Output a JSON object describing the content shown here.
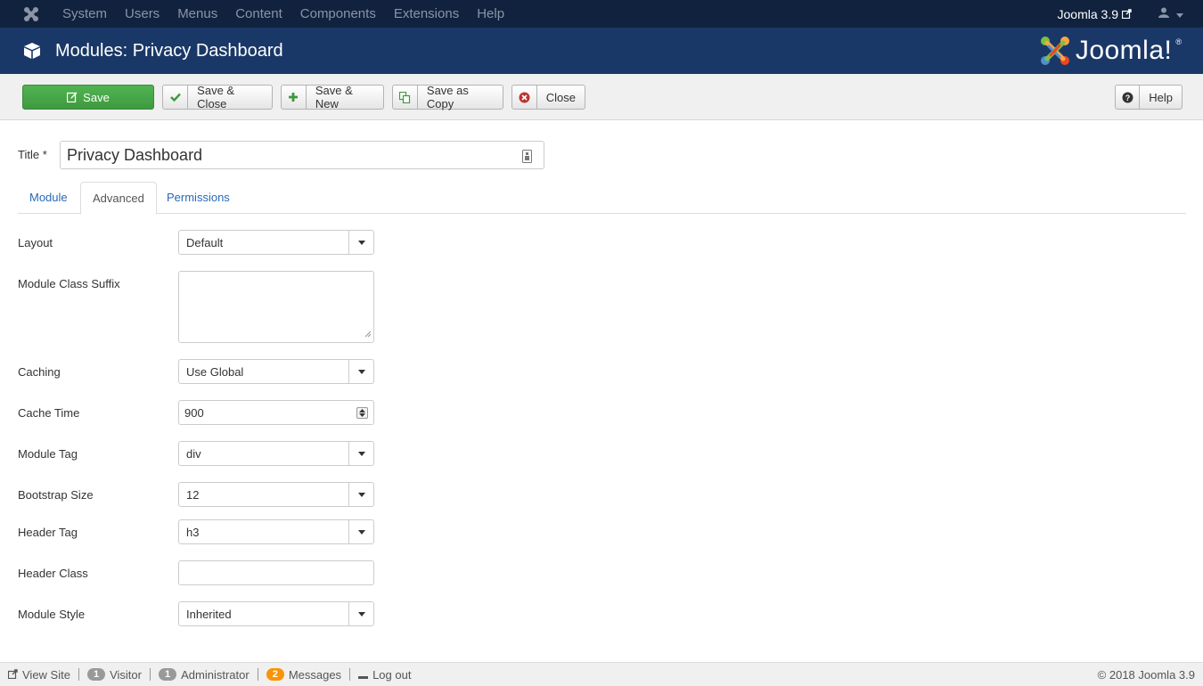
{
  "navbar": {
    "menu": [
      "System",
      "Users",
      "Menus",
      "Content",
      "Components",
      "Extensions",
      "Help"
    ],
    "version": "Joomla 3.9"
  },
  "header": {
    "title": "Modules: Privacy Dashboard",
    "brand": "Joomla!",
    "brand_mark": "®"
  },
  "toolbar": {
    "save": "Save",
    "save_close": "Save & Close",
    "save_new": "Save & New",
    "save_copy": "Save as Copy",
    "close": "Close",
    "help": "Help"
  },
  "title_field": {
    "label": "Title *",
    "value": "Privacy Dashboard"
  },
  "tabs": [
    "Module",
    "Advanced",
    "Permissions"
  ],
  "active_tab": "Advanced",
  "form": {
    "layout": {
      "label": "Layout",
      "value": "Default"
    },
    "module_class_suffix": {
      "label": "Module Class Suffix",
      "value": ""
    },
    "caching": {
      "label": "Caching",
      "value": "Use Global"
    },
    "cache_time": {
      "label": "Cache Time",
      "value": "900"
    },
    "module_tag": {
      "label": "Module Tag",
      "value": "div"
    },
    "bootstrap_size": {
      "label": "Bootstrap Size",
      "value": "12"
    },
    "header_tag": {
      "label": "Header Tag",
      "value": "h3"
    },
    "header_class": {
      "label": "Header Class",
      "value": ""
    },
    "module_style": {
      "label": "Module Style",
      "value": "Inherited"
    }
  },
  "statusbar": {
    "view_site": "View Site",
    "visitor_count": "1",
    "visitor": "Visitor",
    "admin_count": "1",
    "admin": "Administrator",
    "messages_count": "2",
    "messages": "Messages",
    "logout": "Log out",
    "copyright": "© 2018 Joomla 3.9"
  },
  "colors": {
    "navbar": "#10223e",
    "header": "#1a3867",
    "save_green": "#46a546",
    "link_blue": "#2a69b8"
  }
}
